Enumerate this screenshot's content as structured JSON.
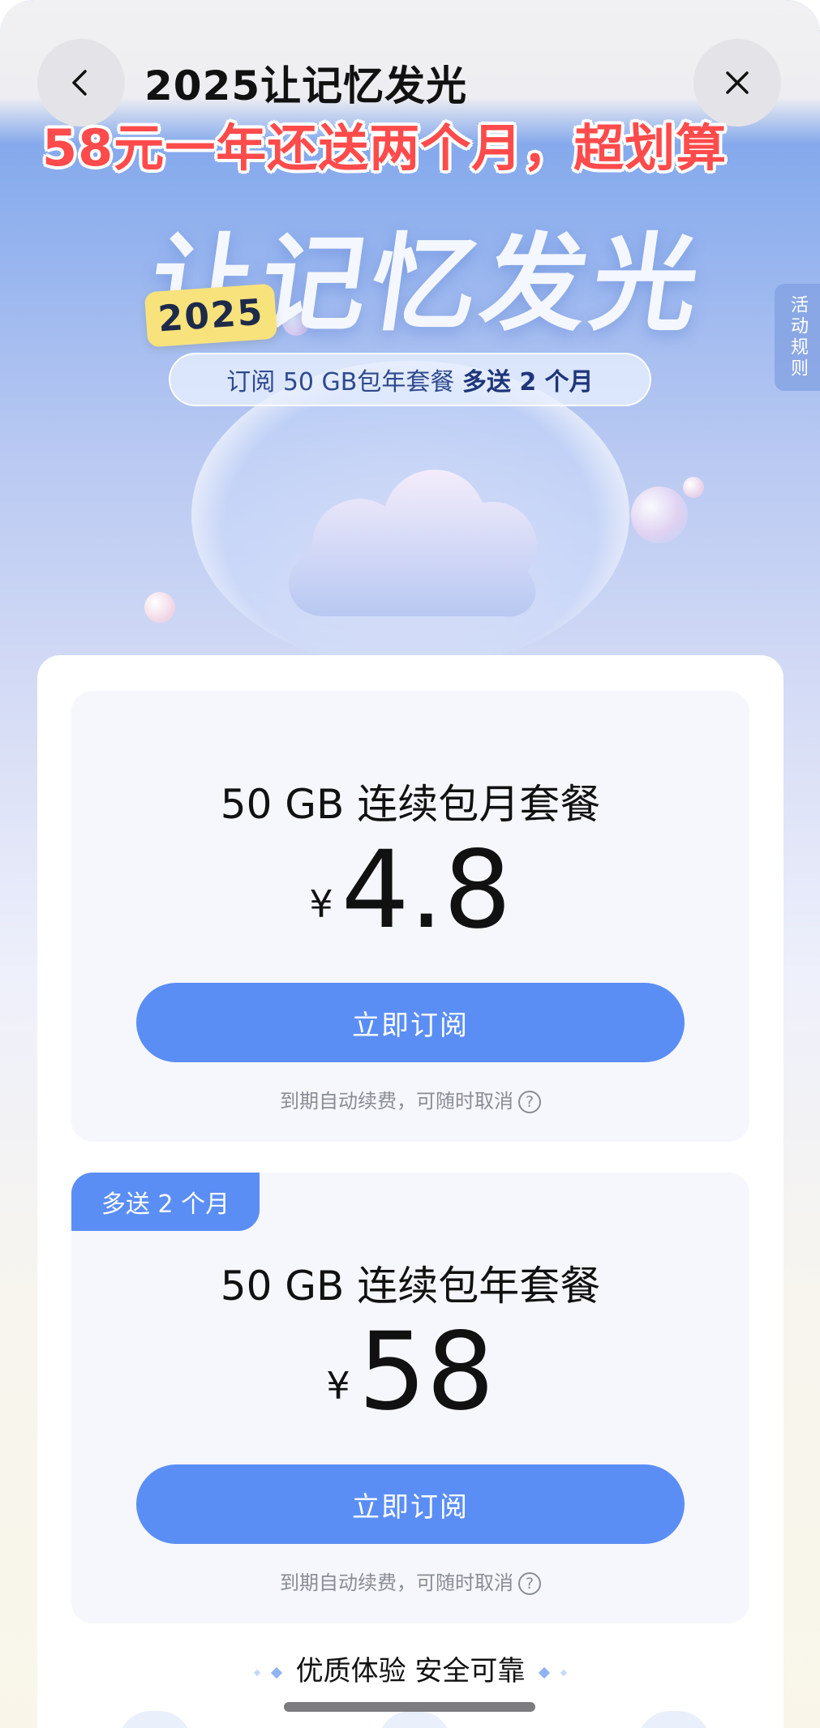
{
  "header": {
    "title": "2025让记忆发光",
    "back_icon": "chevron-left-icon",
    "close_icon": "close-icon"
  },
  "promo_overlay": "58元一年还送两个月，超划算",
  "hero": {
    "title": "让记忆发光",
    "year_badge": "2025",
    "subtitle_prefix": "订阅 50 GB包年套餐",
    "subtitle_emphasis": "多送 2 个月",
    "rules_tab": "活动规则"
  },
  "plans": [
    {
      "tag": "",
      "name": "50 GB 连续包月套餐",
      "currency": "¥",
      "price": "4.8",
      "button": "立即订阅",
      "note": "到期自动续费，可随时取消"
    },
    {
      "tag": "多送 2 个月",
      "name": "50 GB 连续包年套餐",
      "currency": "¥",
      "price": "58",
      "button": "立即订阅",
      "note": "到期自动续费，可随时取消"
    }
  ],
  "footer": {
    "slogan": "优质体验 安全可靠"
  },
  "colors": {
    "accent": "#5b8ef5",
    "promo_red": "#ff4b4b",
    "badge_yellow": "#f8e27c"
  }
}
